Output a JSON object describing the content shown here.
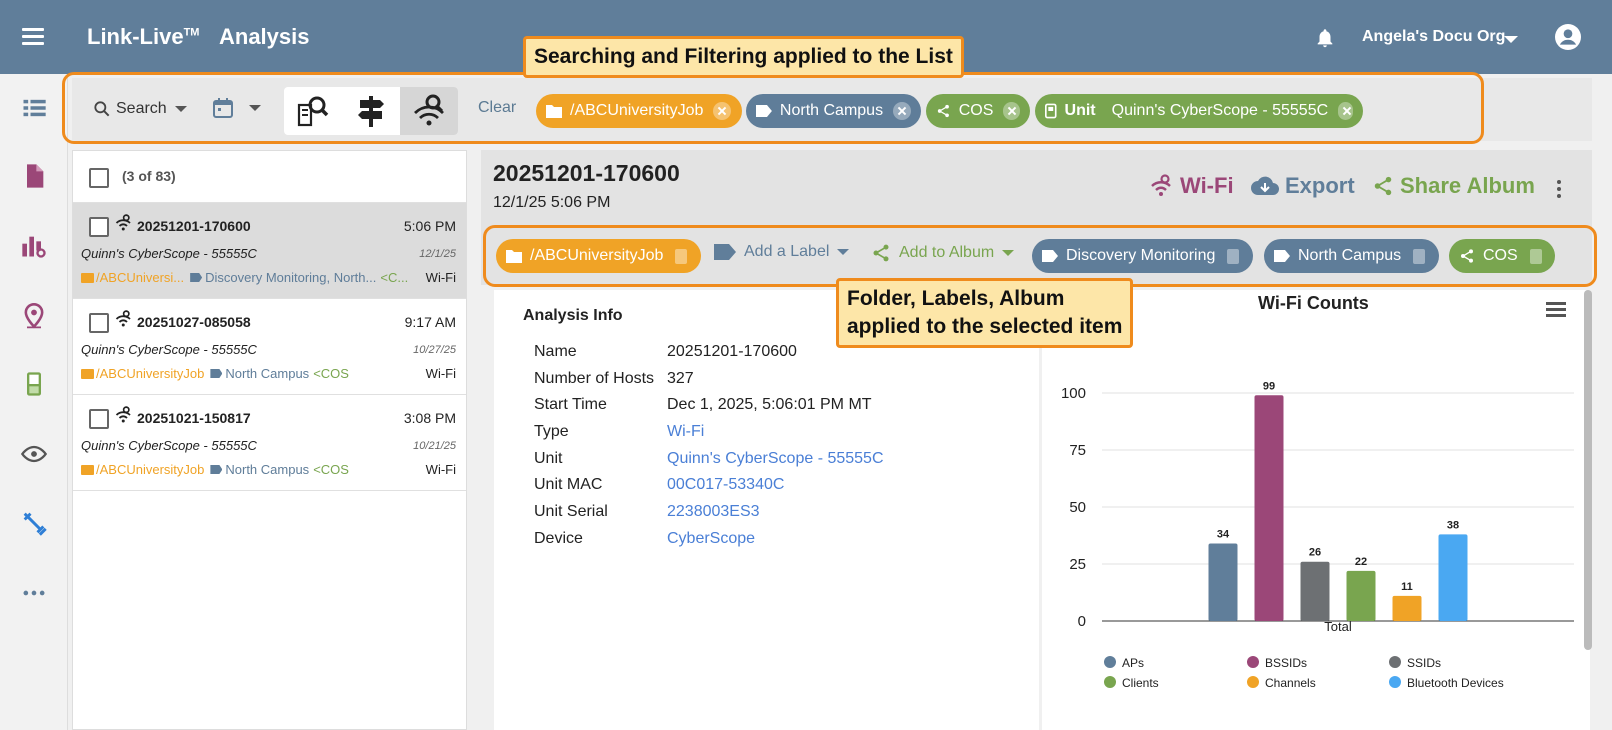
{
  "header": {
    "app_name": "Link-Live",
    "trademark": "TM",
    "page_title": "Analysis",
    "org": "Angela's Docu Org"
  },
  "filters": {
    "search_label": "Search",
    "clear_label": "Clear",
    "chips": [
      {
        "text": "/ABCUniversityJob",
        "kind": "folder",
        "color": "#f0a326"
      },
      {
        "text": "North Campus",
        "kind": "label",
        "color": "#5f7d99"
      },
      {
        "text": "COS",
        "kind": "album",
        "color": "#79a54f"
      },
      {
        "prefix": "Unit",
        "text": "Quinn's CyberScope - 55555C",
        "kind": "unit",
        "color": "#79a54f"
      }
    ]
  },
  "callouts": {
    "top": "Searching and Filtering applied to the List",
    "middle_line1": "Folder, Labels, Album",
    "middle_line2": "applied to the selected item"
  },
  "list": {
    "count": "(3 of 83)",
    "rows": [
      {
        "title": "20251201-170600",
        "time": "5:06 PM",
        "unit": "Quinn's CyberScope - 55555C",
        "date": "12/1/25",
        "folder": "/ABCUniversi...",
        "labels": "Discovery Monitoring, North...",
        "album": "C...",
        "type": "Wi-Fi"
      },
      {
        "title": "20251027-085058",
        "time": "9:17 AM",
        "unit": "Quinn's CyberScope - 55555C",
        "date": "10/27/25",
        "folder": "/ABCUniversityJob",
        "labels": "North Campus",
        "album": "COS",
        "type": "Wi-Fi"
      },
      {
        "title": "20251021-150817",
        "time": "3:08 PM",
        "unit": "Quinn's CyberScope - 55555C",
        "date": "10/21/25",
        "folder": "/ABCUniversityJob",
        "labels": "North Campus",
        "album": "COS",
        "type": "Wi-Fi"
      }
    ]
  },
  "detail": {
    "title": "20251201-170600",
    "subtitle": "12/1/25 5:06 PM",
    "actions": {
      "wifi": "Wi-Fi",
      "export": "Export",
      "share": "Share Album"
    },
    "folder": "/ABCUniversityJob",
    "add_label": "Add a Label",
    "add_album": "Add to Album",
    "tags": [
      "Discovery Monitoring",
      "North Campus",
      "COS"
    ]
  },
  "info": {
    "title": "Analysis Info",
    "rows": [
      {
        "label": "Name",
        "value": "20251201-170600"
      },
      {
        "label": "Number of Hosts",
        "value": "327"
      },
      {
        "label": "Start Time",
        "value": "Dec 1, 2025, 5:06:01 PM MT"
      },
      {
        "label": "Type",
        "value": "Wi-Fi"
      },
      {
        "label": "Unit",
        "value": "Quinn's CyberScope - 55555C"
      },
      {
        "label": "Unit MAC",
        "value": "00C017-53340C"
      },
      {
        "label": "Unit Serial",
        "value": "2238003ES3"
      },
      {
        "label": "Device",
        "value": "CyberScope"
      }
    ]
  },
  "chart_data": {
    "type": "bar",
    "title": "Wi-Fi Counts",
    "xlabel": "Total",
    "ylabel": "",
    "ylim": [
      0,
      100
    ],
    "yticks": [
      0,
      25,
      50,
      75,
      100
    ],
    "categories": [
      "Total"
    ],
    "legend_position": "bottom",
    "grid": true,
    "series": [
      {
        "name": "APs",
        "values": [
          34
        ],
        "color": "#607e9a"
      },
      {
        "name": "BSSIDs",
        "values": [
          99
        ],
        "color": "#9b4778"
      },
      {
        "name": "SSIDs",
        "values": [
          26
        ],
        "color": "#6d7073"
      },
      {
        "name": "Clients",
        "values": [
          22
        ],
        "color": "#79a54f"
      },
      {
        "name": "Channels",
        "values": [
          11
        ],
        "color": "#f0a326"
      },
      {
        "name": "Bluetooth Devices",
        "values": [
          38
        ],
        "color": "#4aa8f2"
      }
    ]
  }
}
